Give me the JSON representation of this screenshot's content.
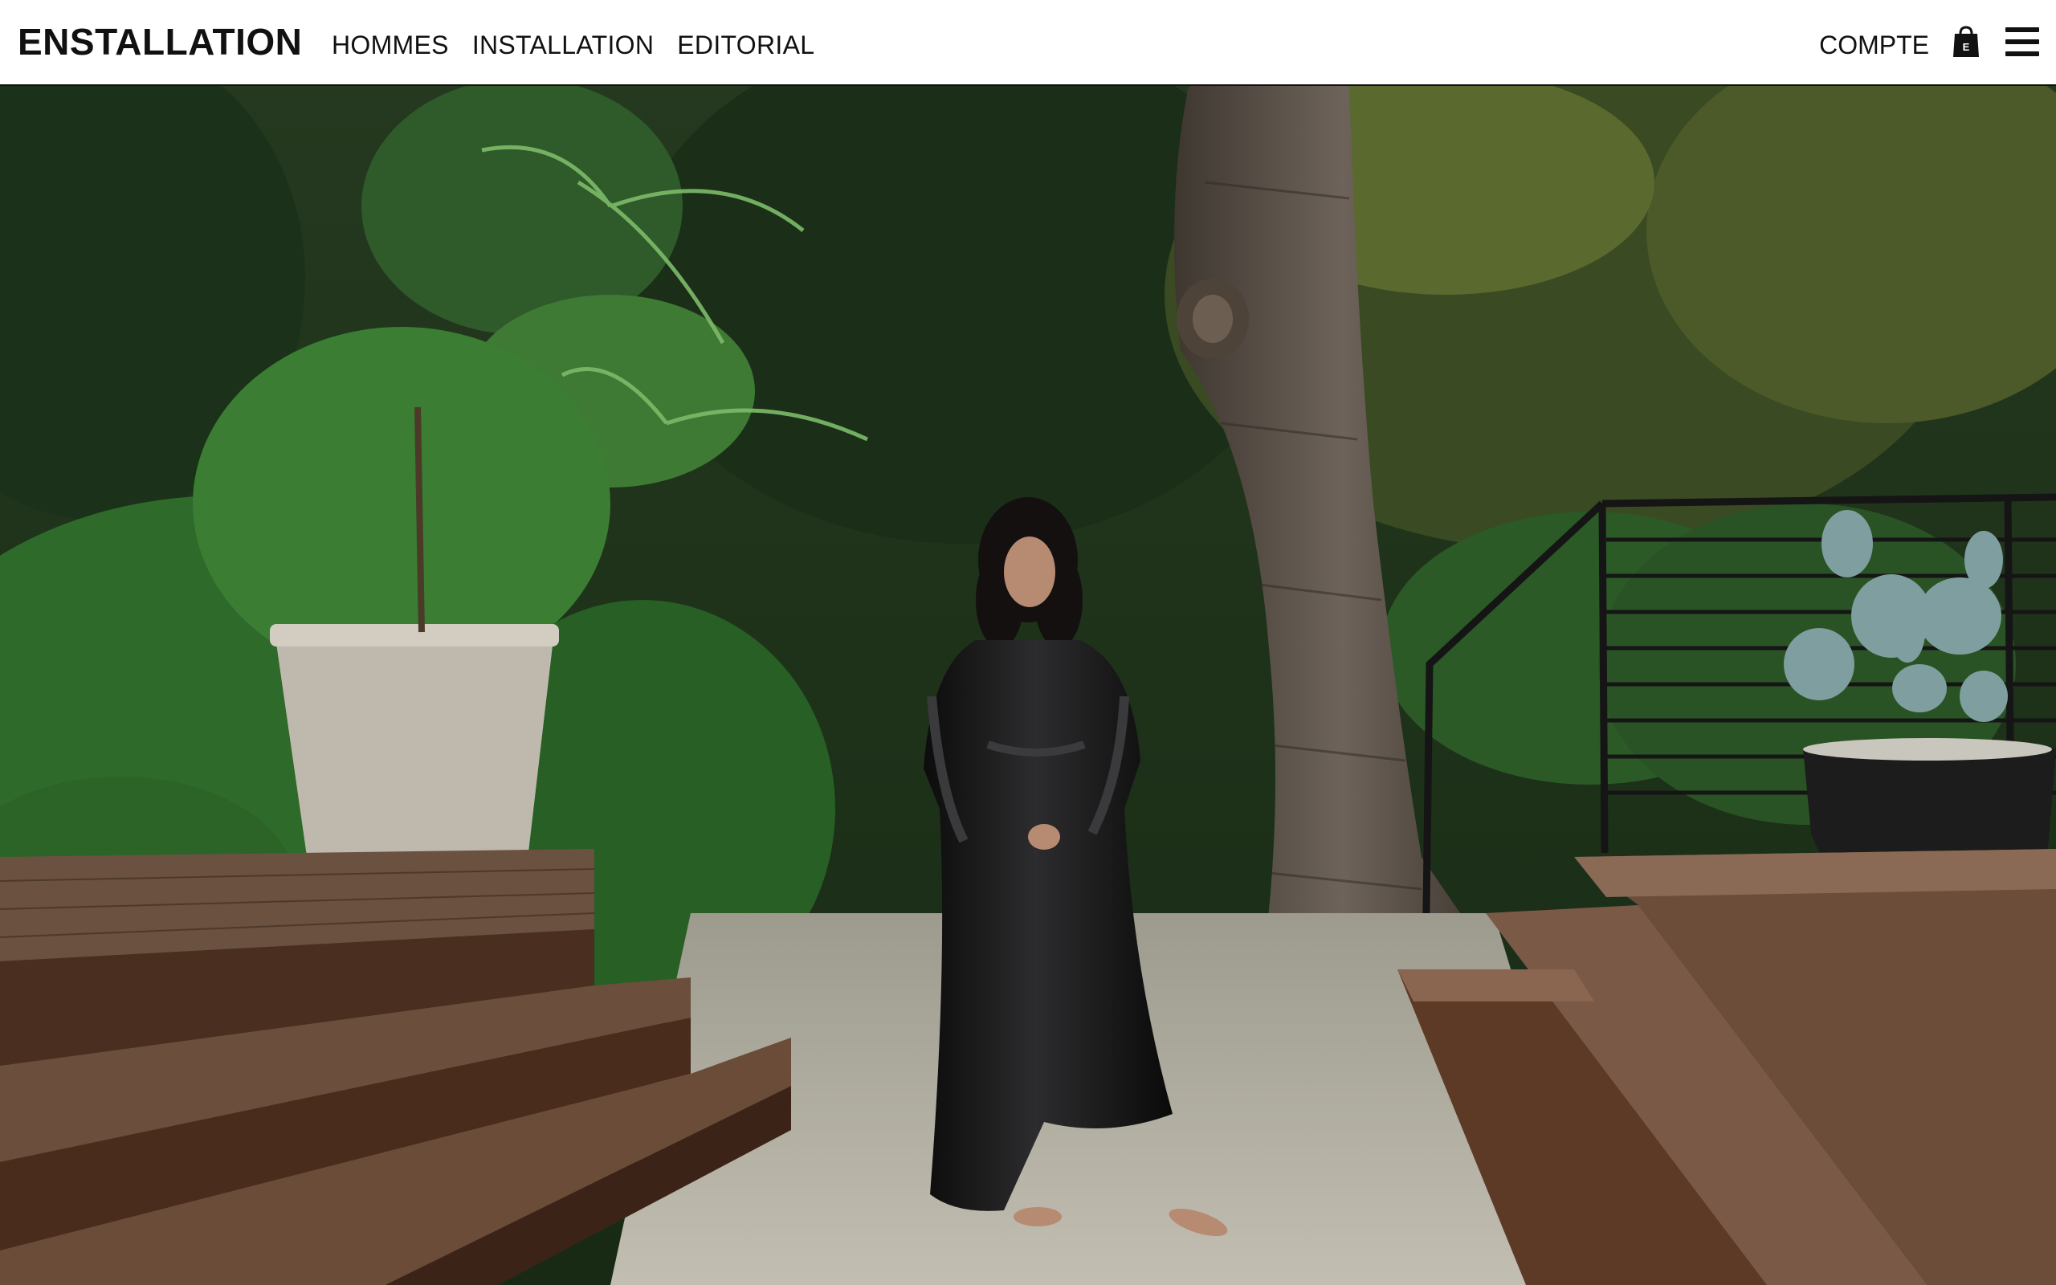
{
  "brand": {
    "logo": "ENSTALLATION"
  },
  "nav": {
    "items": [
      {
        "label": "HOMMES"
      },
      {
        "label": "INSTALLATION"
      },
      {
        "label": "EDITORIAL"
      }
    ]
  },
  "utility": {
    "account_label": "COMPTE",
    "bag_icon": "shopping-bag-icon",
    "bag_icon_letter": "E",
    "menu_icon": "hamburger-menu-icon"
  },
  "hero": {
    "image_alt": "Model in black satin coat standing barefoot on gravel path in a garden",
    "slide_count": 5,
    "active_slide": 2
  },
  "colors": {
    "text": "#111111",
    "background": "#ffffff",
    "indicator": "#ffffff",
    "indicator_active": "#0c0c0c"
  }
}
